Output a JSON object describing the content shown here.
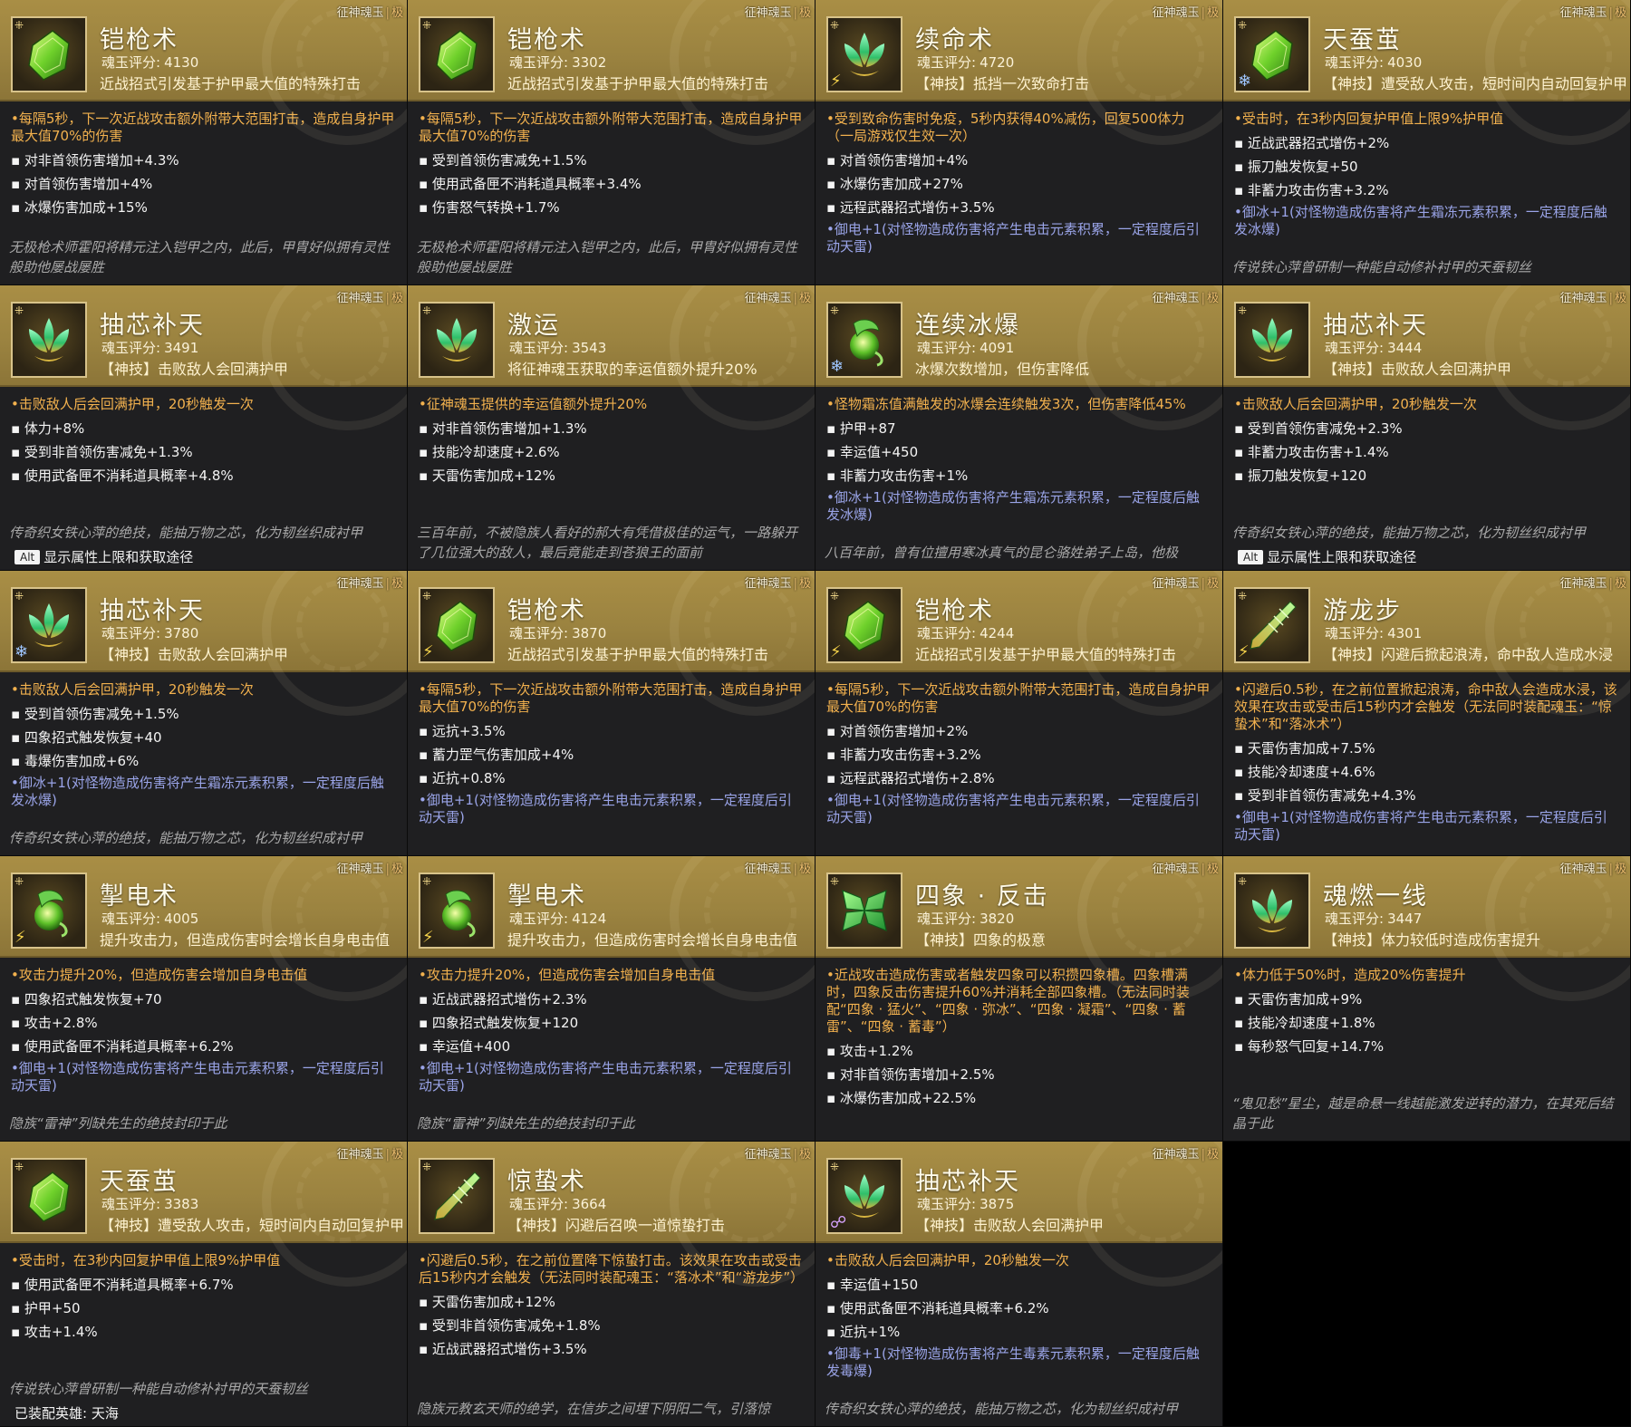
{
  "header_tag": "征神魂玉",
  "grade": "极",
  "score_label": "魂玉评分:",
  "alt_key": "Alt",
  "colors": {
    "header_gold": "#a98e45",
    "main_effect": "#f2b14e",
    "elemental": "#9aa4e8",
    "body_bg": "#1f1f21"
  },
  "cards": [
    {
      "icon": "gauntlet-icon",
      "element": "none",
      "name": "铠枪术",
      "score": "4130",
      "desc": "近战招式引发基于护甲最大值的特殊打击",
      "main": "•每隔5秒，下一次近战攻击额外附带大范围打击，造成自身护甲最大值70%的伤害",
      "stats": [
        "对非首领伤害增加+4.3%",
        "对首领伤害增加+4%",
        "冰爆伤害加成+15%"
      ],
      "elemental": "",
      "flavor": "无极枪术师霍阳将精元注入铠甲之内，此后，甲胄好似拥有灵性般助他屡战屡胜",
      "footer": ""
    },
    {
      "icon": "gauntlet-icon",
      "element": "none",
      "name": "铠枪术",
      "score": "3302",
      "desc": "近战招式引发基于护甲最大值的特殊打击",
      "main": "•每隔5秒，下一次近战攻击额外附带大范围打击，造成自身护甲最大值70%的伤害",
      "stats": [
        "受到首领伤害减免+1.5%",
        "使用武备匣不消耗道具概率+3.4%",
        "伤害怒气转换+1.7%"
      ],
      "elemental": "",
      "flavor": "无极枪术师霍阳将精元注入铠甲之内，此后，甲胄好似拥有灵性般助他屡战屡胜",
      "footer": ""
    },
    {
      "icon": "lotus-icon",
      "element": "lightning",
      "name": "续命术",
      "score": "4720",
      "desc": "【神技】抵挡一次致命打击",
      "main": "•受到致命伤害时免疫，5秒内获得40%减伤，回复500体力（一局游戏仅生效一次）",
      "stats": [
        "对首领伤害增加+4%",
        "冰爆伤害加成+27%",
        "远程武器招式增伤+3.5%"
      ],
      "elemental": "•御电+1(对怪物造成伤害将产生电击元素积累，一定程度后引动天雷)",
      "flavor": "",
      "footer": ""
    },
    {
      "icon": "gauntlet-icon",
      "element": "frost",
      "name": "天蚕茧",
      "score": "4030",
      "desc": "【神技】遭受敌人攻击，短时间内自动回复护甲值",
      "main": "•受击时，在3秒内回复护甲值上限9%护甲值",
      "stats": [
        "近战武器招式增伤+2%",
        "振刀触发恢复+50",
        "非蓄力攻击伤害+3.2%"
      ],
      "elemental": "•御冰+1(对怪物造成伤害将产生霜冻元素积累，一定程度后触发冰爆)",
      "flavor": "传说铁心萍曾研制一种能自动修补衬甲的天蚕韧丝",
      "footer": ""
    },
    {
      "icon": "lotus-icon",
      "element": "none",
      "name": "抽芯补天",
      "score": "3491",
      "desc": "【神技】击败敌人会回满护甲",
      "main": "•击败敌人后会回满护甲，20秒触发一次",
      "stats": [
        "体力+8%",
        "受到非首领伤害减免+1.3%",
        "使用武备匣不消耗道具概率+4.8%"
      ],
      "elemental": "",
      "flavor": "传奇织女铁心萍的绝技，能抽万物之芯，化为韧丝织成衬甲",
      "footer": "显示属性上限和获取途径"
    },
    {
      "icon": "lotus-icon",
      "element": "none",
      "name": "激运",
      "score": "3543",
      "desc": "将征神魂玉获取的幸运值额外提升20%",
      "main": "•征神魂玉提供的幸运值额外提升20%",
      "stats": [
        "对非首领伤害增加+1.3%",
        "技能冷却速度+2.6%",
        "天雷伤害加成+12%"
      ],
      "elemental": "",
      "flavor": "三百年前，不被隐族人看好的郝大有凭借极佳的运气，一路躲开了几位强大的敌人，最后竟能走到苍狼王的面前",
      "footer": ""
    },
    {
      "icon": "orb-icon",
      "element": "frost",
      "name": "连续冰爆",
      "score": "4091",
      "desc": "冰爆次数增加，但伤害降低",
      "main": "•怪物霜冻值满触发的冰爆会连续触发3次，但伤害降低45%",
      "stats": [
        "护甲+87",
        "幸运值+450",
        "非蓄力攻击伤害+1%"
      ],
      "elemental": "•御冰+1(对怪物造成伤害将产生霜冻元素积累，一定程度后触发冰爆)",
      "flavor": "八百年前，曾有位擅用寒冰真气的昆仑骆姓弟子上岛，他极",
      "footer": ""
    },
    {
      "icon": "lotus-icon",
      "element": "none",
      "name": "抽芯补天",
      "score": "3444",
      "desc": "【神技】击败敌人会回满护甲",
      "main": "•击败敌人后会回满护甲，20秒触发一次",
      "stats": [
        "受到首领伤害减免+2.3%",
        "非蓄力攻击伤害+1.4%",
        "振刀触发恢复+120"
      ],
      "elemental": "",
      "flavor": "传奇织女铁心萍的绝技，能抽万物之芯，化为韧丝织成衬甲",
      "footer": "显示属性上限和获取途径"
    },
    {
      "icon": "lotus-icon",
      "element": "frost",
      "name": "抽芯补天",
      "score": "3780",
      "desc": "【神技】击败敌人会回满护甲",
      "main": "•击败敌人后会回满护甲，20秒触发一次",
      "stats": [
        "受到首领伤害减免+1.5%",
        "四象招式触发恢复+40",
        "毒爆伤害加成+6%"
      ],
      "elemental": "•御冰+1(对怪物造成伤害将产生霜冻元素积累，一定程度后触发冰爆)",
      "flavor": "传奇织女铁心萍的绝技，能抽万物之芯，化为韧丝织成衬甲",
      "footer": ""
    },
    {
      "icon": "gauntlet-icon",
      "element": "lightning",
      "name": "铠枪术",
      "score": "3870",
      "desc": "近战招式引发基于护甲最大值的特殊打击",
      "main": "•每隔5秒，下一次近战攻击额外附带大范围打击，造成自身护甲最大值70%的伤害",
      "stats": [
        "远抗+3.5%",
        "蓄力罡气伤害加成+4%",
        "近抗+0.8%"
      ],
      "elemental": "•御电+1(对怪物造成伤害将产生电击元素积累，一定程度后引动天雷)",
      "flavor": "",
      "footer": ""
    },
    {
      "icon": "gauntlet-icon",
      "element": "lightning",
      "name": "铠枪术",
      "score": "4244",
      "desc": "近战招式引发基于护甲最大值的特殊打击",
      "main": "•每隔5秒，下一次近战攻击额外附带大范围打击，造成自身护甲最大值70%的伤害",
      "stats": [
        "对首领伤害增加+2%",
        "非蓄力攻击伤害+3.2%",
        "远程武器招式增伤+2.8%"
      ],
      "elemental": "•御电+1(对怪物造成伤害将产生电击元素积累，一定程度后引动天雷)",
      "flavor": "",
      "footer": ""
    },
    {
      "icon": "spear-icon",
      "element": "lightning",
      "name": "游龙步",
      "score": "4301",
      "desc": "【神技】闪避后掀起浪涛，命中敌人造成水浸",
      "main": "•闪避后0.5秒，在之前位置掀起浪涛，命中敌人会造成水浸，该效果在攻击或受击后15秒内才会触发（无法同时装配魂玉：“惊蛰术”和“落冰术”）",
      "stats": [
        "天雷伤害加成+7.5%",
        "技能冷却速度+4.6%",
        "受到非首领伤害减免+4.3%"
      ],
      "elemental": "•御电+1(对怪物造成伤害将产生电击元素积累，一定程度后引动天雷)",
      "flavor": "",
      "footer": ""
    },
    {
      "icon": "orb-icon",
      "element": "lightning",
      "name": "掣电术",
      "score": "4005",
      "desc": "提升攻击力，但造成伤害时会增长自身电击值",
      "main": "•攻击力提升20%，但造成伤害会增加自身电击值",
      "stats": [
        "四象招式触发恢复+70",
        "攻击+2.8%",
        "使用武备匣不消耗道具概率+6.2%"
      ],
      "elemental": "•御电+1(对怪物造成伤害将产生电击元素积累，一定程度后引动天雷)",
      "flavor": "隐族“雷神”列缺先生的绝技封印于此",
      "footer": ""
    },
    {
      "icon": "orb-icon",
      "element": "lightning",
      "name": "掣电术",
      "score": "4124",
      "desc": "提升攻击力，但造成伤害时会增长自身电击值",
      "main": "•攻击力提升20%，但造成伤害会增加自身电击值",
      "stats": [
        "近战武器招式增伤+2.3%",
        "四象招式触发恢复+120",
        "幸运值+400"
      ],
      "elemental": "•御电+1(对怪物造成伤害将产生电击元素积累，一定程度后引动天雷)",
      "flavor": "隐族“雷神”列缺先生的绝技封印于此",
      "footer": ""
    },
    {
      "icon": "crystal-icon",
      "element": "none",
      "name": "四象 · 反击",
      "score": "3820",
      "desc": "【神技】四象的极意",
      "main": "•近战攻击造成伤害或者触发四象可以积攒四象槽。四象槽满时，四象反击伤害提升60%并消耗全部四象槽。（无法同时装配“四象 · 猛火”、“四象 · 弥冰”、“四象 · 凝霜”、“四象 · 蓄雷”、“四象 · 蓄毒”）",
      "stats": [
        "攻击+1.2%",
        "对非首领伤害增加+2.5%",
        "冰爆伤害加成+22.5%"
      ],
      "elemental": "",
      "flavor": "",
      "footer": ""
    },
    {
      "icon": "lotus-icon",
      "element": "none",
      "name": "魂燃一线",
      "score": "3447",
      "desc": "【神技】体力较低时造成伤害提升",
      "main": "•体力低于50%时，造成20%伤害提升",
      "stats": [
        "天雷伤害加成+9%",
        "技能冷却速度+1.8%",
        "每秒怒气回复+14.7%"
      ],
      "elemental": "",
      "flavor": "“鬼见愁”星尘，越是命悬一线越能激发逆转的潜力，在其死后结晶于此",
      "footer": ""
    },
    {
      "icon": "gauntlet-icon",
      "element": "none",
      "name": "天蚕茧",
      "score": "3383",
      "desc": "【神技】遭受敌人攻击，短时间内自动回复护甲值",
      "main": "•受击时，在3秒内回复护甲值上限9%护甲值",
      "stats": [
        "使用武备匣不消耗道具概率+6.7%",
        "护甲+50",
        "攻击+1.4%"
      ],
      "elemental": "",
      "flavor": "传说铁心萍曾研制一种能自动修补衬甲的天蚕韧丝",
      "footer": "已装配英雄: 天海"
    },
    {
      "icon": "spear-icon",
      "element": "none",
      "name": "惊蛰术",
      "score": "3664",
      "desc": "【神技】闪避后召唤一道惊蛰打击",
      "main": "•闪避后0.5秒，在之前位置降下惊蛰打击。该效果在攻击或受击后15秒内才会触发（无法同时装配魂玉：“落冰术”和“游龙步”）",
      "stats": [
        "天雷伤害加成+12%",
        "受到非首领伤害减免+1.8%",
        "近战武器招式增伤+3.5%"
      ],
      "elemental": "",
      "flavor": "隐族元教玄天师的绝学，在信步之间埋下阴阳二气，引落惊",
      "footer": ""
    },
    {
      "icon": "lotus-icon",
      "element": "poison",
      "name": "抽芯补天",
      "score": "3875",
      "desc": "【神技】击败敌人会回满护甲",
      "main": "•击败敌人后会回满护甲，20秒触发一次",
      "stats": [
        "幸运值+150",
        "使用武备匣不消耗道具概率+6.2%",
        "近抗+1%"
      ],
      "elemental": "•御毒+1(对怪物造成伤害将产生毒素元素积累，一定程度后触发毒爆)",
      "flavor": "传奇织女铁心萍的绝技，能抽万物之芯，化为韧丝织成衬甲",
      "footer": ""
    }
  ]
}
